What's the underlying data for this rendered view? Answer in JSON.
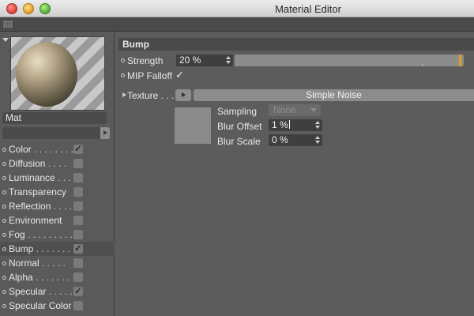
{
  "window": {
    "title": "Material Editor"
  },
  "material": {
    "name": "Mat"
  },
  "channels": [
    {
      "label": "Color",
      "dots": " . . . . . . . .",
      "checked": true
    },
    {
      "label": "Diffusion",
      "dots": " . . . .",
      "checked": false
    },
    {
      "label": "Luminance",
      "dots": " . . .",
      "checked": false
    },
    {
      "label": "Transparency",
      "dots": "",
      "checked": false
    },
    {
      "label": "Reflection",
      "dots": " . . . .",
      "checked": false
    },
    {
      "label": "Environment",
      "dots": "",
      "checked": false
    },
    {
      "label": "Fog",
      "dots": " . . . . . . . . . .",
      "checked": false
    },
    {
      "label": "Bump",
      "dots": " . . . . . . . .",
      "checked": true,
      "active": true
    },
    {
      "label": "Normal",
      "dots": " . . . . .",
      "checked": false
    },
    {
      "label": "Alpha",
      "dots": " . . . . . . .",
      "checked": false
    },
    {
      "label": "Specular",
      "dots": " . . . . .",
      "checked": true
    },
    {
      "label": "Specular Color",
      "dots": "",
      "checked": false
    }
  ],
  "bump": {
    "header": "Bump",
    "strength_label": "Strength",
    "strength_value": "20 %",
    "strength_fraction": 0.99,
    "mip_label": "MIP Falloff",
    "mip_checked": true,
    "texture_label": "Texture . . .",
    "texture_name": "Simple Noise",
    "sampling_label": "Sampling",
    "sampling_value": "None",
    "blur_offset_label": "Blur Offset",
    "blur_offset_value": "1 %",
    "blur_scale_label": "Blur Scale",
    "blur_scale_value": "0 %"
  },
  "colors": {
    "accent_handle": "#e0a21c",
    "panel_bg": "#5c5c5c",
    "field_bg": "#3f3f3f"
  }
}
